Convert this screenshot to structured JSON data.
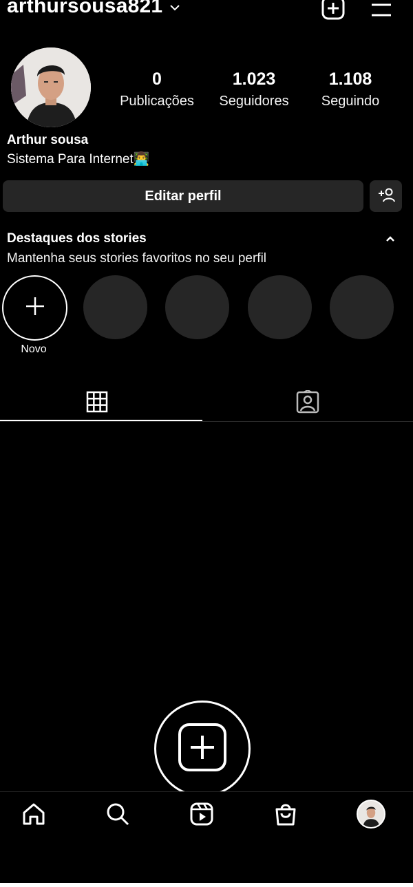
{
  "header": {
    "username": "arthursousa821",
    "icons": [
      "chevron-down-icon",
      "new-post-icon",
      "menu-icon"
    ]
  },
  "profile": {
    "stats": [
      {
        "value": "0",
        "label": "Publicações"
      },
      {
        "value": "1.023",
        "label": "Seguidores"
      },
      {
        "value": "1.108",
        "label": "Seguindo"
      }
    ],
    "name": "Arthur sousa",
    "bio": "Sistema Para Internet👨‍💻",
    "edit_label": "Editar perfil"
  },
  "highlights": {
    "title": "Destaques dos stories",
    "subtitle": "Mantenha seus stories favoritos no seu perfil",
    "new_label": "Novo"
  },
  "tabs": [
    "grid-icon",
    "tagged-icon"
  ],
  "nav": [
    "home-icon",
    "search-icon",
    "reels-icon",
    "shop-icon",
    "profile-avatar"
  ],
  "colors": {
    "background": "#000000",
    "button": "#262626",
    "text": "#ffffff"
  }
}
